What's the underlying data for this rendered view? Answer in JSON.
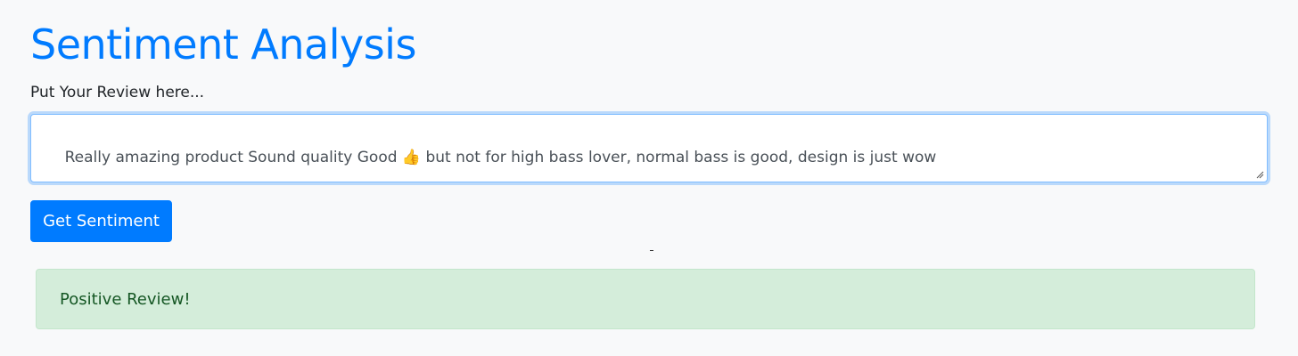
{
  "page": {
    "title": "Sentiment Analysis",
    "prompt_label": "Put Your Review here..."
  },
  "review": {
    "value": "Really amazing product Sound quality Good 👍 but not for high bass lover, normal bass is good, design is just wow"
  },
  "actions": {
    "get_sentiment_label": "Get Sentiment"
  },
  "result": {
    "message": "Positive Review!"
  },
  "colors": {
    "accent": "#007bff",
    "success_bg": "#d4edda",
    "success_text": "#155724"
  }
}
